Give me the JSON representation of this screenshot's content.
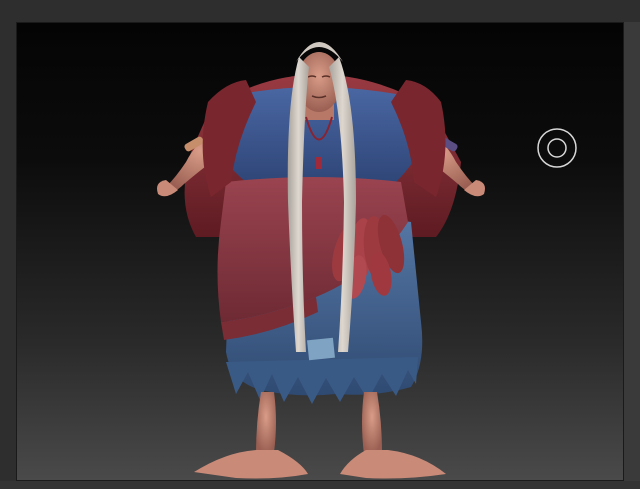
{
  "app": {
    "background_top": "#040404",
    "background_bottom": "#4a4a4a"
  },
  "canvas": {
    "subject": "sculpted-character",
    "brush_cursor_icon": "circle-brush-cursor-icon"
  },
  "colors": {
    "skin": "#c98a78",
    "skin_shadow": "#9a5f52",
    "shawl": "#8a2f36",
    "shawl_dark": "#5e1b22",
    "blouse": "#3f5a93",
    "skirt": "#4d6f9a",
    "skirt_dark": "#2f4a72",
    "sash": "#8e3b44",
    "feathers": "#9c3a40",
    "hair": "#c9c3bc",
    "patch": "#7fa3c2",
    "cursor": "#d8d8d8"
  }
}
